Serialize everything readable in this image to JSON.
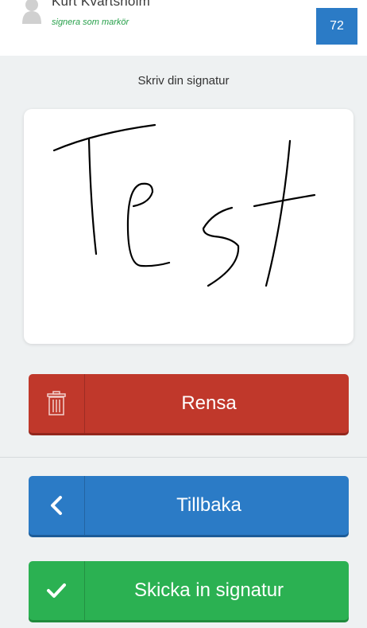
{
  "header": {
    "user_name": "Kurt Kvartsholm",
    "user_role": "signera som markör",
    "count_badge": "72",
    "avatar_icon": "user-avatar-icon"
  },
  "signature": {
    "prompt": "Skriv din signatur",
    "drawn_text": "Test"
  },
  "buttons": {
    "clear": {
      "label": "Rensa",
      "icon": "trash-icon",
      "color": "#c0382b"
    },
    "back": {
      "label": "Tillbaka",
      "icon": "chevron-left-icon",
      "color": "#2b7bc6"
    },
    "submit": {
      "label": "Skicka in signatur",
      "icon": "checkmark-icon",
      "color": "#2bb152"
    }
  }
}
